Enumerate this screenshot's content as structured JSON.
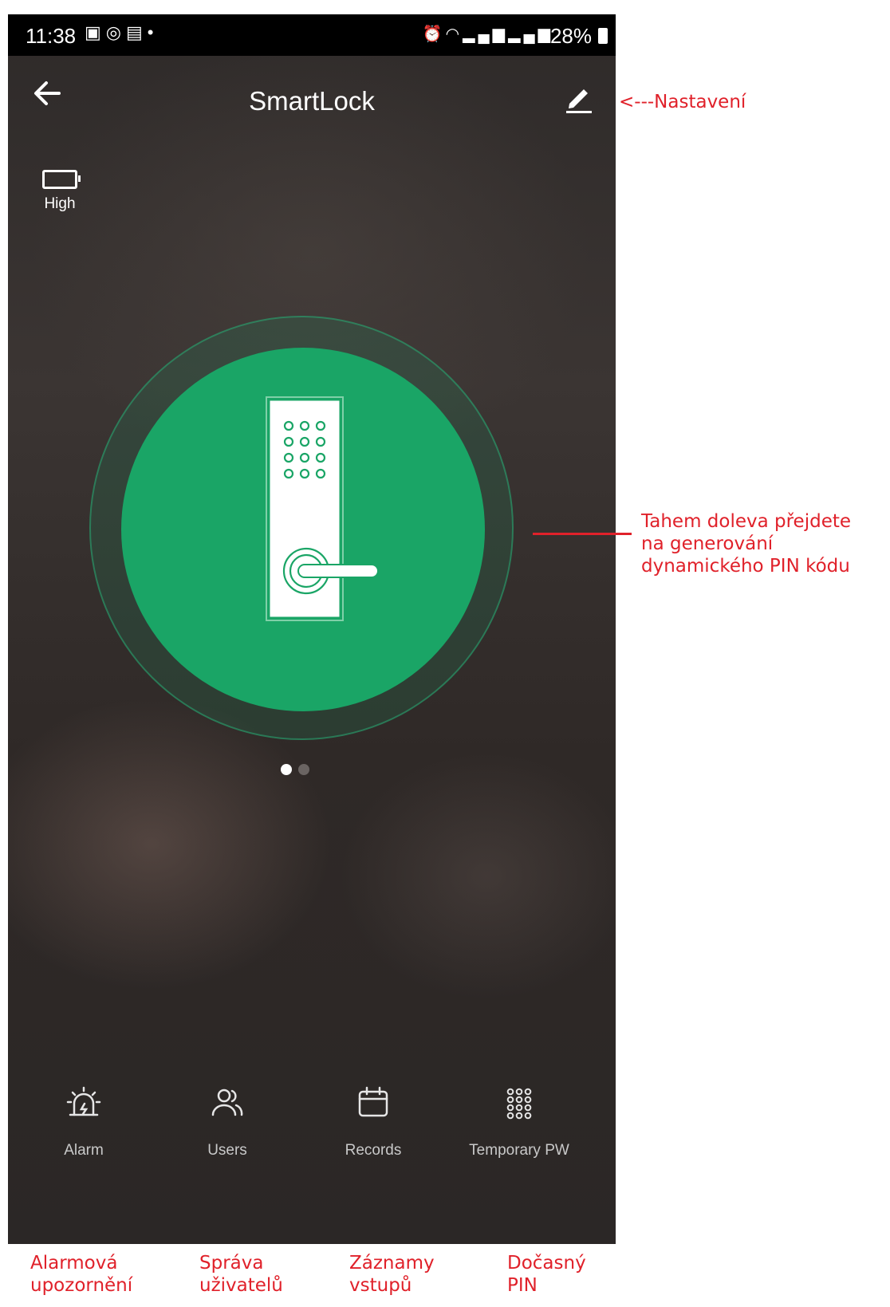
{
  "status_bar": {
    "time": "11:38",
    "notification_icons": [
      "gallery-icon",
      "whatsapp-icon",
      "cast-icon",
      "dot-icon"
    ],
    "system_icons": [
      "alarm-icon",
      "wifi-icon",
      "signal-icon",
      "signal-icon"
    ],
    "battery_percent": "28%"
  },
  "header": {
    "title": "SmartLock",
    "back_icon": "arrow-left-icon",
    "edit_icon": "pencil-icon"
  },
  "battery": {
    "level_label": "High"
  },
  "lock": {
    "icon": "door-lock-keypad-icon",
    "color": "#1aa566"
  },
  "pager": {
    "pages": 2,
    "active_index": 0
  },
  "bottom_nav": [
    {
      "label": "Alarm",
      "icon": "alarm-siren-icon"
    },
    {
      "label": "Users",
      "icon": "users-icon"
    },
    {
      "label": "Records",
      "icon": "calendar-icon"
    },
    {
      "label": "Temporary PW",
      "icon": "keypad-dots-icon"
    }
  ],
  "annotations": {
    "settings": "<---Nastavení",
    "swipe_line1": "Tahem doleva přejdete",
    "swipe_line2": "na generování",
    "swipe_line3": "dynamického PIN kódu",
    "nav_alarm_line1": "Alarmová",
    "nav_alarm_line2": "upozornění",
    "nav_users_line1": "Správa",
    "nav_users_line2": "uživatelů",
    "nav_records_line1": "Záznamy",
    "nav_records_line2": "vstupů",
    "nav_temp_line1": "Dočasný",
    "nav_temp_line2": "PIN",
    "color": "#e0212a"
  }
}
